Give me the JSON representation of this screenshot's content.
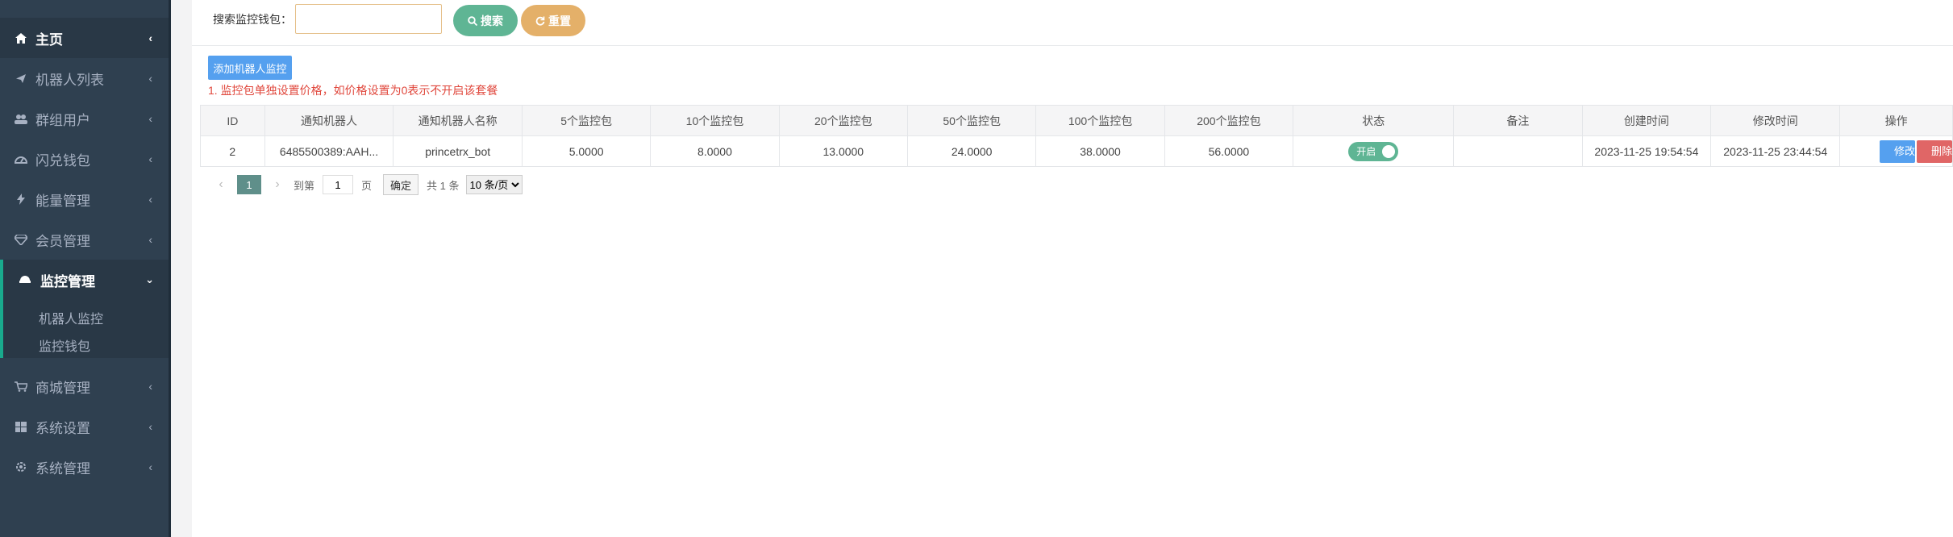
{
  "sidebar": {
    "items": [
      {
        "label": "主页",
        "icon": "home-icon"
      },
      {
        "label": "机器人列表",
        "icon": "plane-icon"
      },
      {
        "label": "群组用户",
        "icon": "users-icon"
      },
      {
        "label": "闪兑钱包",
        "icon": "gauge-icon"
      },
      {
        "label": "能量管理",
        "icon": "bolt-icon"
      },
      {
        "label": "会员管理",
        "icon": "diamond-icon"
      },
      {
        "label": "监控管理",
        "icon": "monitor-icon",
        "expanded": true,
        "children": [
          "机器人监控",
          "监控钱包"
        ]
      },
      {
        "label": "商城管理",
        "icon": "cart-icon"
      },
      {
        "label": "系统设置",
        "icon": "windows-icon"
      },
      {
        "label": "系统管理",
        "icon": "gear-icon"
      }
    ]
  },
  "search": {
    "label": "搜索监控钱包：",
    "value": "",
    "search_btn": "搜索",
    "reset_btn": "重置"
  },
  "toolbar": {
    "add_btn": "添加机器人监控",
    "note": "1. 监控包单独设置价格，如价格设置为0表示不开启该套餐"
  },
  "table": {
    "headers": [
      "ID",
      "通知机器人",
      "通知机器人名称",
      "5个监控包",
      "10个监控包",
      "20个监控包",
      "50个监控包",
      "100个监控包",
      "200个监控包",
      "状态",
      "备注",
      "创建时间",
      "修改时间",
      "操作"
    ],
    "rows": [
      {
        "id": "2",
        "bot": "6485500389:AAH...",
        "bot_name": "princetrx_bot",
        "p5": "5.0000",
        "p10": "8.0000",
        "p20": "13.0000",
        "p50": "24.0000",
        "p100": "38.0000",
        "p200": "56.0000",
        "status": "开启",
        "remark": "",
        "created": "2023-11-25 19:54:54",
        "modified": "2023-11-25 23:44:54",
        "edit": "修改",
        "delete": "删除"
      }
    ]
  },
  "pager": {
    "current": "1",
    "goto_label": "到第",
    "goto_value": "1",
    "page_unit": "页",
    "confirm": "确定",
    "total": "共 1 条",
    "per_page": "10 条/页"
  },
  "colors": {
    "sidebar_bg": "#2f4050",
    "accent_green": "#5fb594",
    "accent_orange": "#e4b069",
    "accent_blue": "#55a0ef",
    "danger": "#e06666",
    "note_red": "#e0473c"
  }
}
